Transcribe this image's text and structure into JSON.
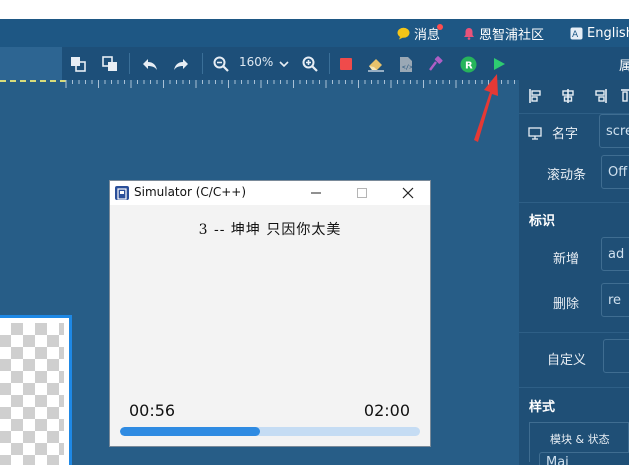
{
  "header": {
    "messages_label": "消息",
    "community_label": "恩智浦社区",
    "language_label": "English"
  },
  "toolbar": {
    "zoom_value": "160%"
  },
  "properties_panel": {
    "title": "属",
    "name_label": "名字",
    "name_value": "scre",
    "scrollbar_label": "滚动条",
    "scrollbar_value": "Off",
    "flags_heading": "标识",
    "add_label": "新增",
    "add_value": "ad",
    "remove_label": "删除",
    "remove_value": "re",
    "custom_label": "自定义",
    "style_heading": "样式",
    "part_state_label": "模块 & 状态",
    "part_value": "Mai"
  },
  "simulator": {
    "title": "Simulator (C/C++)",
    "lyric_text": "3 -- 坤坤   只因你太美",
    "current_time": "00:56",
    "total_time": "02:00",
    "progress_fraction": 0.467
  },
  "colors": {
    "accent_blue": "#2f8be2",
    "annotation_red": "#e53935",
    "run_green": "#2ecc71"
  }
}
